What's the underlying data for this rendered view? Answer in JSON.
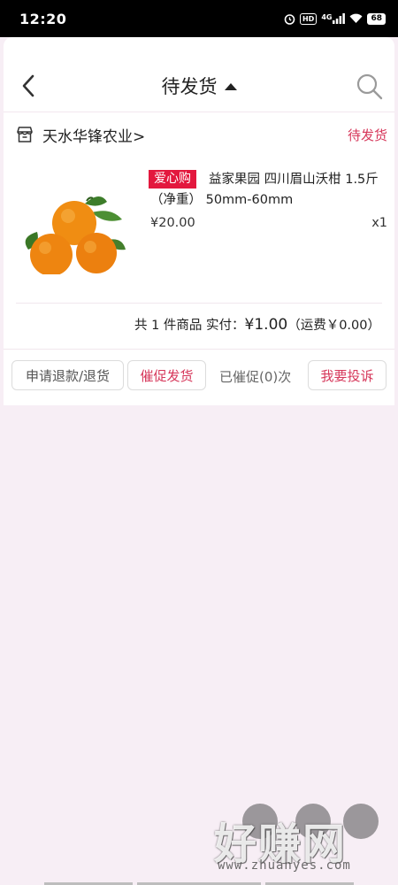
{
  "status_bar": {
    "time": "12:20",
    "icons": [
      "alarm-icon",
      "hd-icon",
      "4g-signal-icon",
      "wifi-icon",
      "battery-icon"
    ],
    "hd_label": "HD",
    "network": "4G",
    "battery": "68"
  },
  "header": {
    "title": "待发货",
    "back_icon": "chevron-left-icon",
    "search_icon": "search-icon"
  },
  "order": {
    "shop_name": "天水华锋农业>",
    "status": "待发货",
    "product": {
      "badge": "爱心购",
      "title": "益家果园 四川眉山沃柑 1.5斤（净重） 50mm-60mm",
      "price": "¥20.00",
      "quantity": "x1"
    },
    "summary": {
      "prefix": "共 1 件商品  实付：",
      "amount": "¥1.00",
      "shipping": "（运费￥0.00）"
    },
    "actions": {
      "refund": "申请退款/退货",
      "urge": "催促发货",
      "urged": "已催促(0)次",
      "complain": "我要投诉"
    }
  },
  "watermark": {
    "text": "好赚网",
    "url": "www.zhuanyes.com"
  },
  "colors": {
    "accent": "#d6375a",
    "badge": "#e3183e",
    "background": "#f7eef5"
  }
}
